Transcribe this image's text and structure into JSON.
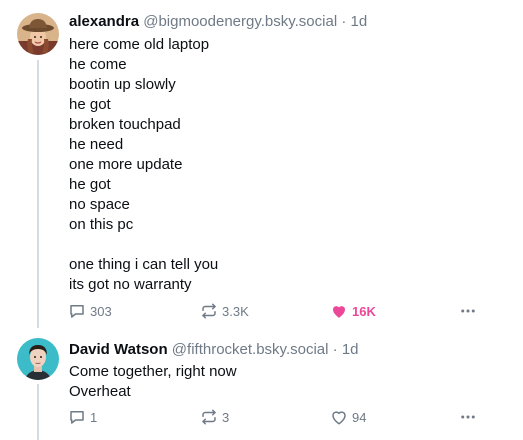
{
  "posts": [
    {
      "author": {
        "display_name": "alexandra",
        "handle": "@bigmoodenergy.bsky.social",
        "avatar_icon": "avatar-woman-hat-icon"
      },
      "separator": "·",
      "time": "1d",
      "text": "here come old laptop\nhe come\nbootin up slowly\nhe got\nbroken touchpad\nhe need\none more update\nhe got\nno space\non this pc\n\none thing i can tell you\nits got no warranty",
      "replies": "303",
      "reposts": "3.3K",
      "likes": "16K",
      "liked": true
    },
    {
      "author": {
        "display_name": "David Watson",
        "handle": "@fifthrocket.bsky.social",
        "avatar_icon": "avatar-man-icon"
      },
      "separator": "·",
      "time": "1d",
      "text": "Come together, right now\nOverheat",
      "replies": "1",
      "reposts": "3",
      "likes": "94",
      "liked": false
    }
  ],
  "colors": {
    "text": "#0b0f14",
    "muted": "#6f7a86",
    "like_active": "#ec4899",
    "thread_line": "#d4dbe2"
  }
}
